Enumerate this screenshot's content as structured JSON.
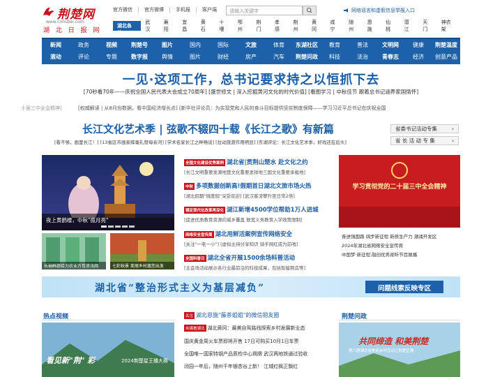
{
  "brand": {
    "logo_text": "荆楚网",
    "url": "www.cnhubei.com",
    "sub": "湖 北 日 报 网",
    "accent": "#1c61a9",
    "red": "#c9121b"
  },
  "top_links": [
    "官方微信",
    "官方微博",
    "手机报",
    "客户端"
  ],
  "search": {
    "placeholder": "请输入关键字"
  },
  "report_link": "网络谣言和虚假信息举报入口",
  "region": {
    "label": "湖北各地",
    "items": [
      "武汉",
      "襄阳",
      "宜昌",
      "黄石",
      "十堰",
      "鄂州",
      "荆门",
      "孝感",
      "荆州",
      "黄冈",
      "咸宁",
      "随州",
      "恩施",
      "仙桃",
      "潜江",
      "天门",
      "神农架"
    ]
  },
  "nav": {
    "row1": [
      "新闻",
      "政务",
      "视频",
      "荆楚号",
      "图片",
      "国内",
      "国际",
      "文旅",
      "体育",
      "东湖社区",
      "教育",
      "普法",
      "文明网",
      "健康",
      "荆楚温度"
    ],
    "row2": [
      "滚动",
      "评论",
      "专题",
      "数字报",
      "舆情",
      "图片",
      "财经",
      "房产",
      "汽车",
      "荆楚问政",
      "科技",
      "法治",
      "青春志",
      "经济",
      "创意产品"
    ]
  },
  "headline": "一见·这项工作，总书记要求持之以恒抓下去",
  "subline": "[70秒看70年——庆祝全国人民代表大会成立70周年] [盛世修文 | 深入挖掘黄河文化的时代价值] [看图学习 | 中秋佳节 跟着总书记涵养家国情怀]",
  "ticker_left": "十届三中全会精神]",
  "ticker": "[权威解读 | 从8月份数据，看中国经济增长点]    [新华社评论员：为实现党和人民的奋斗目标提供坚实制度保障——学习习近平总书记在庆祝全国",
  "article": {
    "title": "长江文化艺术季 | 弦歌不辍四十载《长江之歌》有新篇",
    "sub": "[看不够，画里长江！]  [13省区市画家挥毫礼赞母亲河]  [学术名家长江之畔畅谈]  [拉动旅游作用明显]  [东湖评论：长江文化艺术季，好戏还在后头]"
  },
  "side_tabs": [
    {
      "label": "省委书记活动专集",
      "arrow": "›"
    },
    {
      "label": "省 长 活 动 专 集",
      "arrow": "›"
    }
  ],
  "slide": {
    "caption": "夜上黄鹤楼，中秋\"揽月亮\""
  },
  "thumbs": [
    {
      "caption": "长袖鲜蔬给力农业万卷资讯网"
    },
    {
      "caption": "七彩秋景 美丽乡村邀您出发"
    }
  ],
  "news": [
    {
      "tag": "全国文化建设优秀案例",
      "title": "湖北省|贯荆山楚水 赴文化之约",
      "sub": "[长江文明重要发源地楚文化重要发祥地三国文化重要承载地]"
    },
    {
      "tag": "中秋",
      "title": "多项数据创新高!假期首日湖北文旅市场火热",
      "sub": "[湖北假期\"微度假\"深受欢迎]  [武汉客流攀升至日常2倍]"
    },
    {
      "tag": "镜定现代化改革再深化",
      "title": "湖江新增4500学位帮助1万人进城",
      "sub": "[促进优质教育资源向城乡覆盖 放宽义务教育入学政策限制]"
    },
    {
      "tag": "网络安全宣传周",
      "title": "湖北用鲜活案例宣传网络安全",
      "sub": "[关注\"一老一小\"]  [虚拟主持分享知识 骑手网红成为前哨]"
    },
    {
      "tag": "全国科普日",
      "title": "湖北全省开展1500余场科普活动",
      "sub": "[主会场活动展示各行业最前沿的科技成果，包括智能制造等]"
    }
  ],
  "poster": {
    "text": "学习贯彻党的二十届三中全会精神"
  },
  "right_links": [
    "奋进强国路 阔步新征程    新质生产力 潮涌开发区",
    "2024年湖北省网络安全宣传周",
    "中国梦·新征程:融创优秀视听节目展播"
  ],
  "banner": {
    "text": "湖北省“整治形式主义为基层减负”",
    "button": "问题线索反映专区"
  },
  "sections": {
    "video": "热点视频",
    "wenzheng": "荆楚问政"
  },
  "video": {
    "caption": "看见新\"荆\" 彩",
    "badge": "2024荆楚星王播大赛"
  },
  "bottom_news": [
    {
      "tag": "关注",
      "text": "湖北恩施\"藤茶姐姐\"的微信朋友圈"
    },
    {
      "tag": "央媒看湖北",
      "text": "湖北黄冈：最美自驾路线探索乡村发展新业态"
    },
    {
      "tag": "",
      "text": "国庆黄金周火车票即将开售 17日可购买10月1日车票"
    },
    {
      "tag": "",
      "text": "全国唯一国家特钢产品质检中心揭牌  武汉两地铁通过验收"
    },
    {
      "tag": "",
      "text": "闭园一年后，随州千年银杏谷上新！  江城红枫正飘红"
    }
  ],
  "wenzheng_img": {
    "caption": "共同缔造 和美荆楚",
    "sub": "第六届湖北省美丽乡村活动之荆楚区展"
  }
}
